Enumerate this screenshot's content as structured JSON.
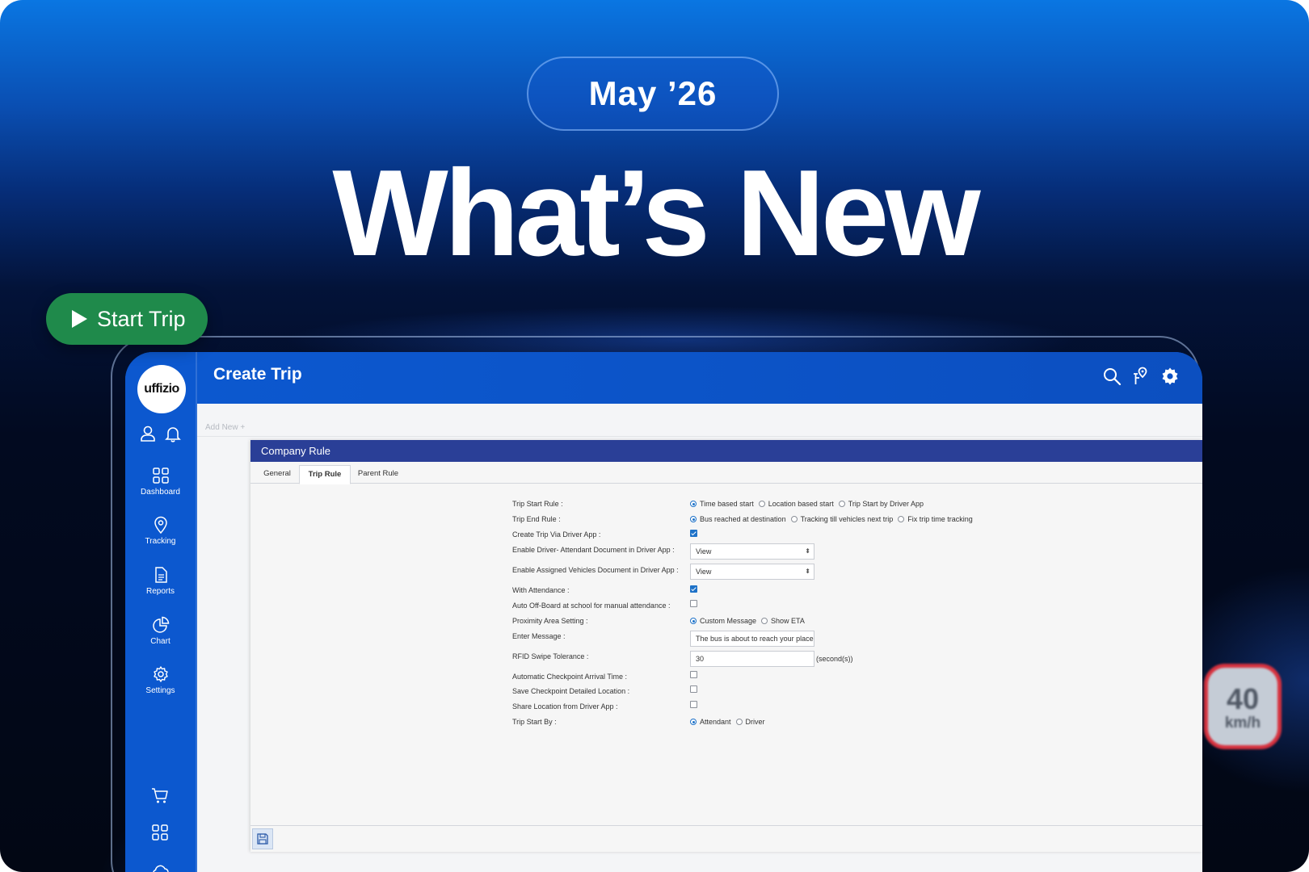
{
  "banner": {
    "date_label": "May ’26",
    "headline": "What’s New",
    "start_trip_label": "Start Trip",
    "speed": {
      "value": "40",
      "unit": "km/h"
    }
  },
  "app": {
    "logo_text": "uffizio",
    "title": "Create Trip",
    "sidebar": [
      {
        "label": "Dashboard",
        "icon": "grid-icon"
      },
      {
        "label": "Tracking",
        "icon": "location-pin-icon"
      },
      {
        "label": "Reports",
        "icon": "document-icon"
      },
      {
        "label": "Chart",
        "icon": "pie-chart-icon"
      },
      {
        "label": "Settings",
        "icon": "gear-icon"
      }
    ],
    "add_new_label": "Add New",
    "panel": {
      "title": "Company Rule",
      "tabs": [
        "General",
        "Trip Rule",
        "Parent Rule"
      ],
      "active_tab": "Trip Rule",
      "rules": {
        "trip_start_rule": {
          "label": "Trip Start Rule :",
          "options": [
            "Time based start",
            "Location based start",
            "Trip Start by Driver App"
          ],
          "selected": "Time based start"
        },
        "trip_end_rule": {
          "label": "Trip End Rule :",
          "options": [
            "Bus reached at destination",
            "Tracking till vehicles next trip",
            "Fix trip time tracking"
          ],
          "selected": "Bus reached at destination"
        },
        "create_trip_via_app": {
          "label": "Create Trip Via Driver App :",
          "checked": true
        },
        "driver_attendant_doc": {
          "label": "Enable Driver- Attendant Document in Driver App :",
          "value": "View"
        },
        "assigned_vehicles_doc": {
          "label": "Enable Assigned Vehicles Document in Driver App :",
          "value": "View"
        },
        "with_attendance": {
          "label": "With Attendance :",
          "checked": true
        },
        "auto_offboard": {
          "label": "Auto Off-Board at school for manual attendance :",
          "checked": false
        },
        "proximity_area": {
          "label": "Proximity Area Setting :",
          "options": [
            "Custom Message",
            "Show ETA"
          ],
          "selected": "Custom Message"
        },
        "enter_message": {
          "label": "Enter Message :",
          "value": "The bus is about to reach your place"
        },
        "rfid_tolerance": {
          "label": "RFID Swipe Tolerance :",
          "value": "30",
          "unit": "(second(s))"
        },
        "auto_checkpoint": {
          "label": "Automatic Checkpoint Arrival Time :",
          "checked": false
        },
        "save_checkpoint": {
          "label": "Save Checkpoint Detailed Location :",
          "checked": false
        },
        "share_location": {
          "label": "Share Location from Driver App :",
          "checked": false
        },
        "trip_start_by": {
          "label": "Trip Start By :",
          "options": [
            "Attendant",
            "Driver"
          ],
          "selected": "Attendant"
        }
      }
    }
  },
  "colors": {
    "accent_blue": "#0c58cf",
    "panel_header": "#2a3f97",
    "start_trip_green": "#1f8a4b",
    "speed_border": "#d7323f"
  }
}
